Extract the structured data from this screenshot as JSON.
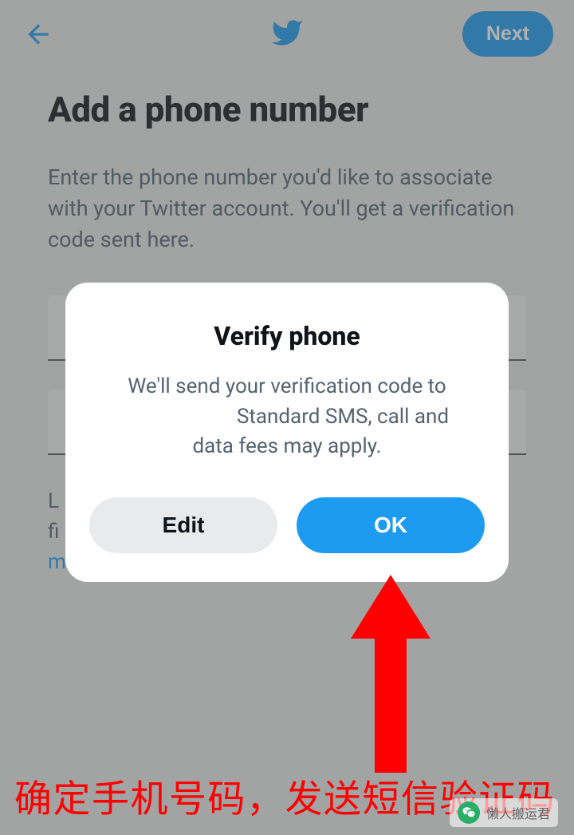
{
  "header": {
    "next_label": "Next"
  },
  "page": {
    "title": "Add a phone number",
    "subtitle": "Enter the phone number you'd like to associate with your Twitter account. You'll get a verification code sent here.",
    "helper_line1": "L",
    "helper_line2": "fi",
    "helper_link": "m"
  },
  "modal": {
    "title": "Verify phone",
    "body_line1": "We'll send your verification code to",
    "body_line2": "Standard SMS, call and",
    "body_line3": "data fees may apply.",
    "edit_label": "Edit",
    "ok_label": "OK"
  },
  "annotation": {
    "caption": "确定手机号码，发送短信验证码",
    "watermark": "懒人搬运君"
  },
  "colors": {
    "accent": "#1d9bf0",
    "danger": "#ff0000"
  }
}
